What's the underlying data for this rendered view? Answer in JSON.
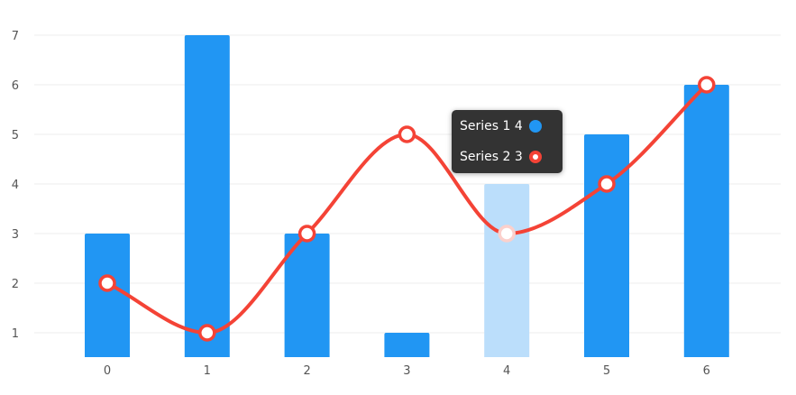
{
  "chart_data": {
    "type": "bar",
    "categories": [
      "0",
      "1",
      "2",
      "3",
      "4",
      "5",
      "6"
    ],
    "y_ticks": [
      1,
      2,
      3,
      4,
      5,
      6,
      7
    ],
    "ylim": [
      0.5,
      7.5
    ],
    "grid": true,
    "series": [
      {
        "name": "Series 1",
        "type": "bar",
        "color": "#2196f3",
        "values": [
          3,
          7,
          3,
          1,
          4,
          5,
          6
        ]
      },
      {
        "name": "Series 2",
        "type": "line",
        "color": "#f44336",
        "values": [
          2,
          1,
          3,
          5,
          3,
          4,
          6
        ]
      }
    ],
    "highlight_index": 4,
    "highlight_color": "#bbdefb"
  },
  "tooltip": {
    "row1": "Series 1 4",
    "row2": "Series 2 3"
  }
}
